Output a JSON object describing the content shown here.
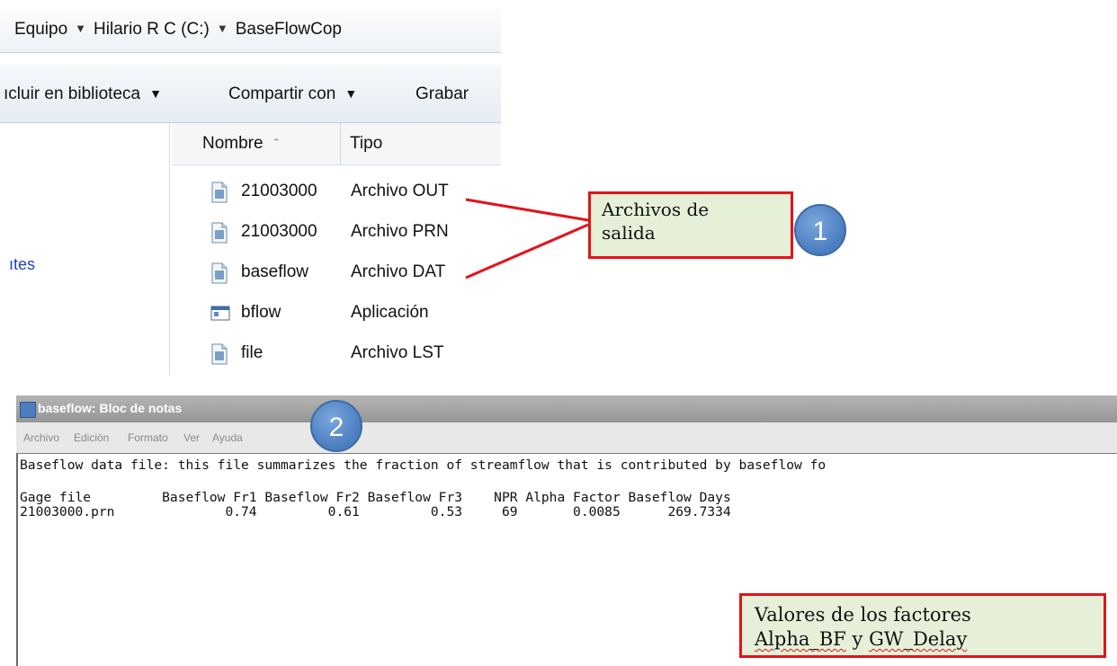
{
  "explorer": {
    "breadcrumb": [
      "Equipo",
      "Hilario R C (C:)",
      "BaseFlowCop"
    ],
    "commands": [
      "ıcluir en biblioteca",
      "Compartir con",
      "Grabar"
    ],
    "columns": {
      "name": "Nombre",
      "type": "Tipo"
    },
    "nav_fragment": "ıtes",
    "files": [
      {
        "name": "21003000",
        "type": "Archivo OUT",
        "icon": "document-icon"
      },
      {
        "name": "21003000",
        "type": "Archivo PRN",
        "icon": "document-icon"
      },
      {
        "name": "baseflow",
        "type": "Archivo DAT",
        "icon": "document-icon"
      },
      {
        "name": "bflow",
        "type": "Aplicación",
        "icon": "application-icon"
      },
      {
        "name": "file",
        "type": "Archivo LST",
        "icon": "document-icon"
      }
    ]
  },
  "callouts": {
    "output_files": {
      "line1": "Archivos de",
      "line2": "salida",
      "number": "1"
    },
    "factors": {
      "line1": "Valores de los factores",
      "word1": "Alpha_BF",
      "word2": " y ",
      "word3": "GW_Delay"
    },
    "notepad_number": "2"
  },
  "notepad": {
    "title": "baseflow: Bloc de notas",
    "menu": [
      "Archivo",
      "Edición",
      "Formato",
      "Ver",
      "Ayuda"
    ],
    "line1": "Baseflow data file: this file summarizes the fraction of streamflow that is contributed by baseflow fo",
    "line2": "Gage file         Baseflow Fr1 Baseflow Fr2 Baseflow Fr3    NPR Alpha Factor Baseflow Days",
    "line3": "21003000.prn              0.74         0.61         0.53     69       0.0085      269.7334"
  },
  "colors": {
    "callout_border": "#e3131b",
    "callout_fill": "#e6f0d8",
    "badge": "#4a7cbf"
  }
}
